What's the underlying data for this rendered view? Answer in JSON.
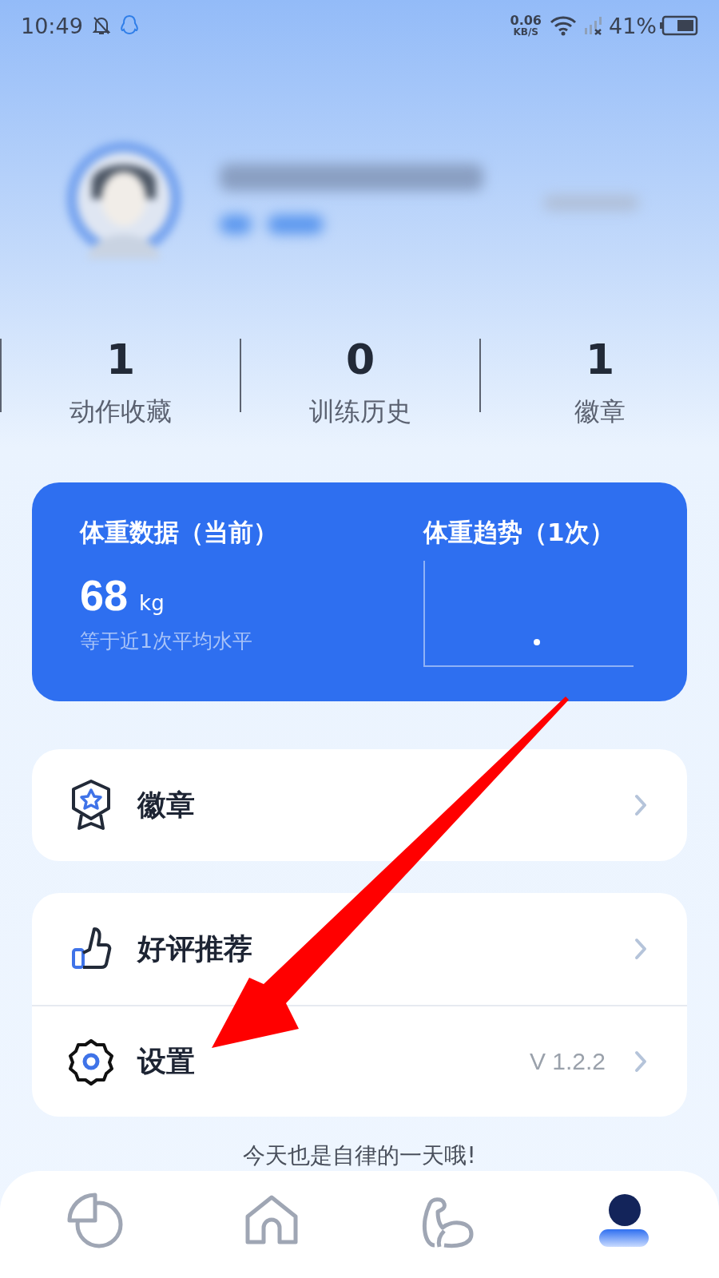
{
  "status_bar": {
    "time": "10:49",
    "net_speed": "0.06",
    "net_unit": "KB/S",
    "battery": "41%"
  },
  "stats": [
    {
      "value": "1",
      "label": "动作收藏"
    },
    {
      "value": "0",
      "label": "训练历史"
    },
    {
      "value": "1",
      "label": "徽章"
    }
  ],
  "weight_card": {
    "title": "体重数据（当前）",
    "value": "68",
    "unit": "kg",
    "note": "等于近1次平均水平",
    "trend_title": "体重趋势（1次）"
  },
  "menu_groups": [
    {
      "items": [
        {
          "kind": "badge",
          "label": "徽章"
        }
      ]
    },
    {
      "items": [
        {
          "kind": "like",
          "label": "好评推荐"
        },
        {
          "kind": "settings",
          "label": "设置",
          "value": "V 1.2.2"
        }
      ]
    }
  ],
  "footer_text": "今天也是自律的一天哦!",
  "bottom_nav": [
    {
      "kind": "stats",
      "selected": false
    },
    {
      "kind": "home",
      "selected": false
    },
    {
      "kind": "muscle",
      "selected": false
    },
    {
      "kind": "profile",
      "selected": true
    }
  ],
  "annotation": {
    "kind": "arrow"
  }
}
